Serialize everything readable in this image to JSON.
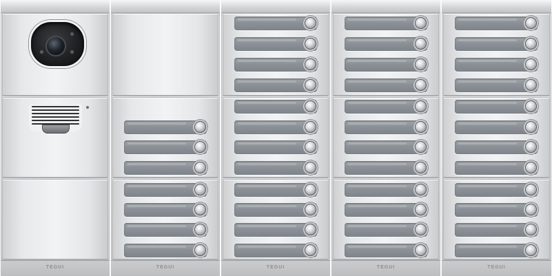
{
  "panel": {
    "brand": "TEGUI",
    "colors": {
      "brushed_aluminium": "#e4e5e7",
      "name_label": "#8b9197",
      "push_button": "#c9cbcd"
    },
    "icons": [
      "camera-icon",
      "speaker-grille-icon",
      "push-button-icon"
    ]
  }
}
